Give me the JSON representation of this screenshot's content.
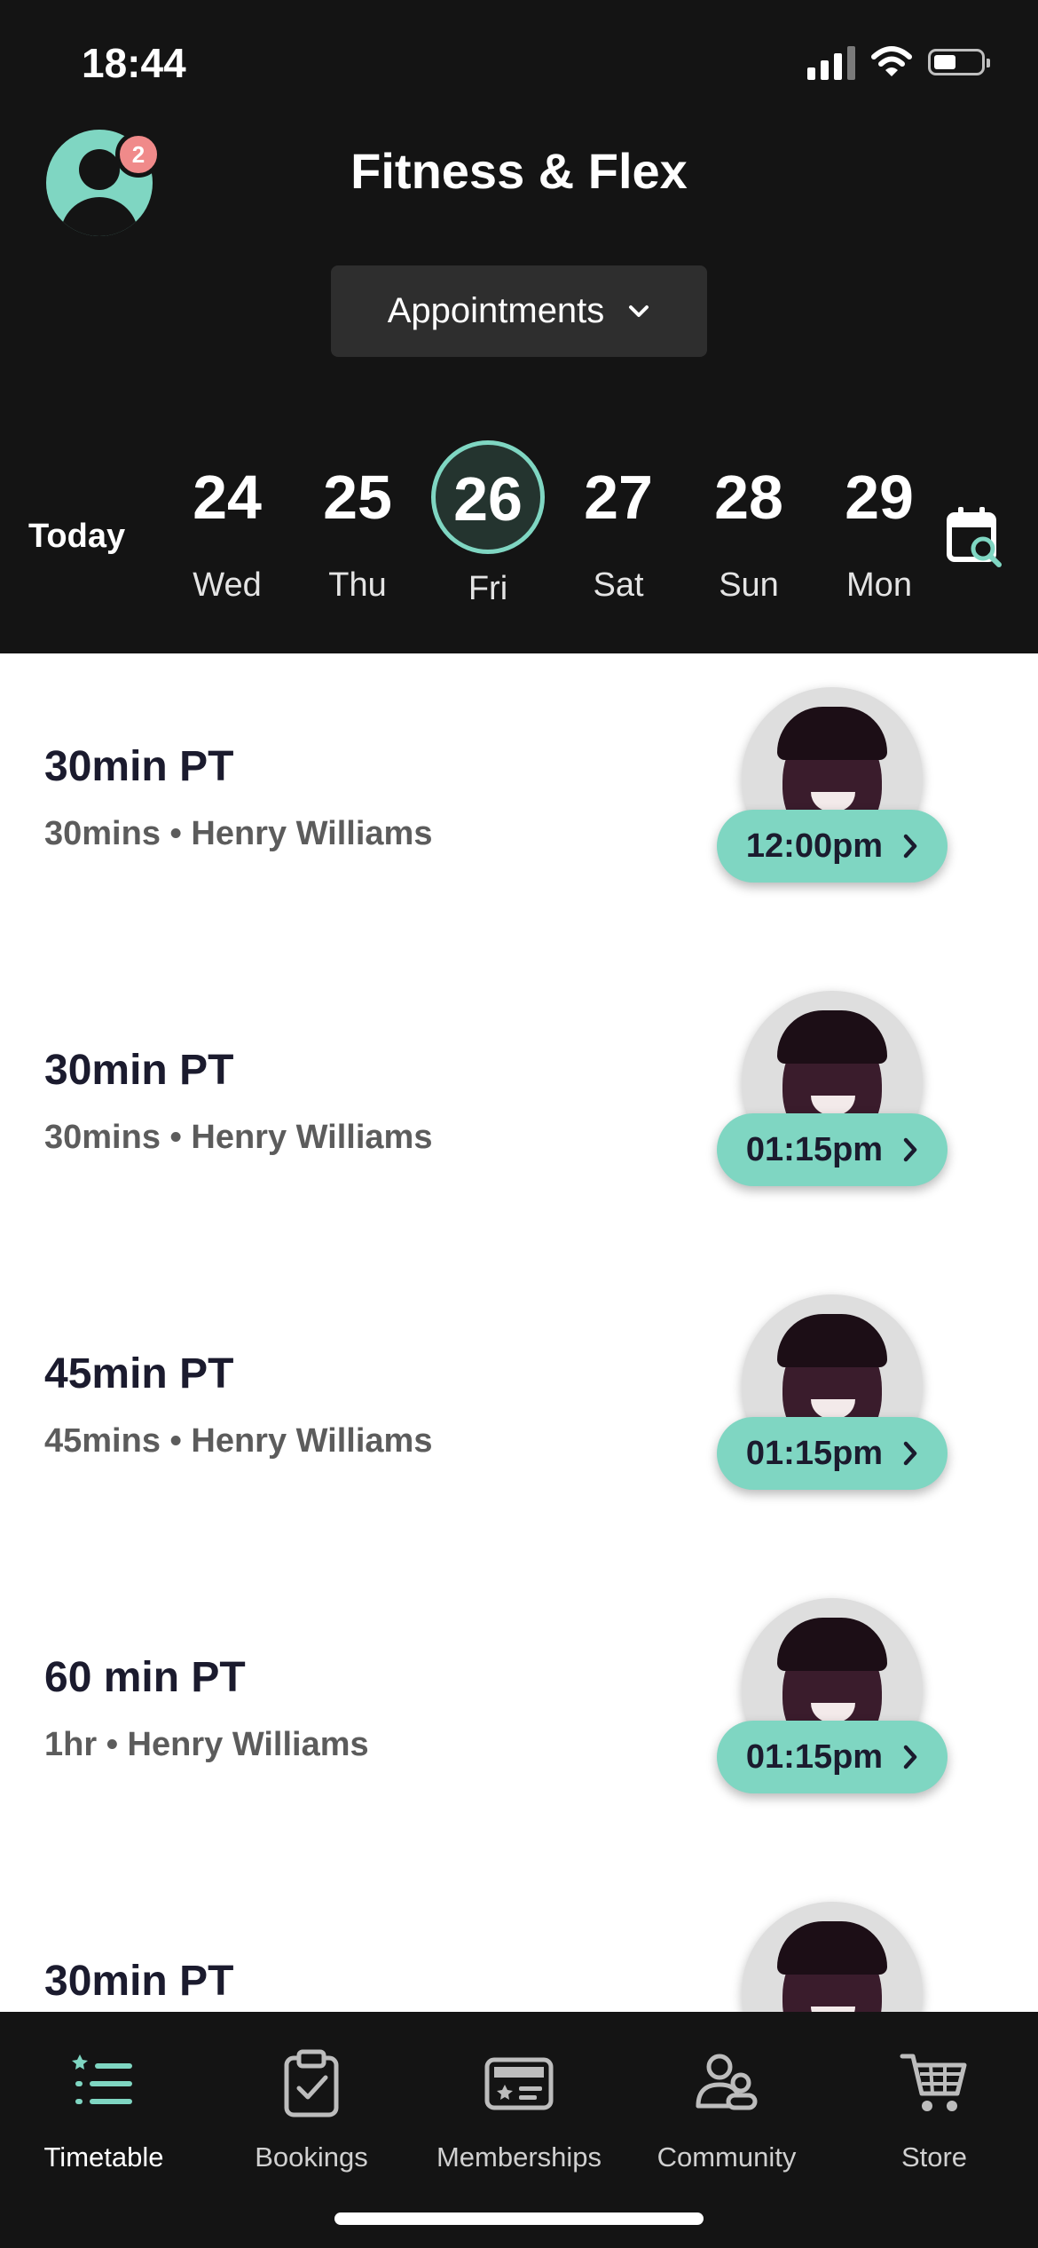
{
  "status_bar": {
    "time": "18:44"
  },
  "header": {
    "notification_count": "2",
    "app_title": "Fitness & Flex",
    "view_selector": "Appointments",
    "today_label": "Today",
    "accent_color": "#7fd6c2",
    "days": [
      {
        "num": "24",
        "name": "Wed"
      },
      {
        "num": "25",
        "name": "Thu"
      },
      {
        "num": "26",
        "name": "Fri",
        "selected": true
      },
      {
        "num": "27",
        "name": "Sat"
      },
      {
        "num": "28",
        "name": "Sun"
      },
      {
        "num": "29",
        "name": "Mon"
      }
    ]
  },
  "appointments": [
    {
      "title": "30min PT",
      "subtitle": "30mins • Henry Williams",
      "time": "12:00pm"
    },
    {
      "title": "30min PT",
      "subtitle": "30mins • Henry Williams",
      "time": "01:15pm"
    },
    {
      "title": "45min PT",
      "subtitle": "45mins • Henry Williams",
      "time": "01:15pm"
    },
    {
      "title": "60 min PT",
      "subtitle": "1hr • Henry Williams",
      "time": "01:15pm"
    },
    {
      "title": "30min PT",
      "subtitle": "",
      "time": ""
    }
  ],
  "tabbar": {
    "items": [
      {
        "label": "Timetable",
        "icon": "list-icon",
        "active": true
      },
      {
        "label": "Bookings",
        "icon": "clipboard-check-icon"
      },
      {
        "label": "Memberships",
        "icon": "membership-card-icon"
      },
      {
        "label": "Community",
        "icon": "people-icon"
      },
      {
        "label": "Store",
        "icon": "cart-icon"
      }
    ]
  }
}
